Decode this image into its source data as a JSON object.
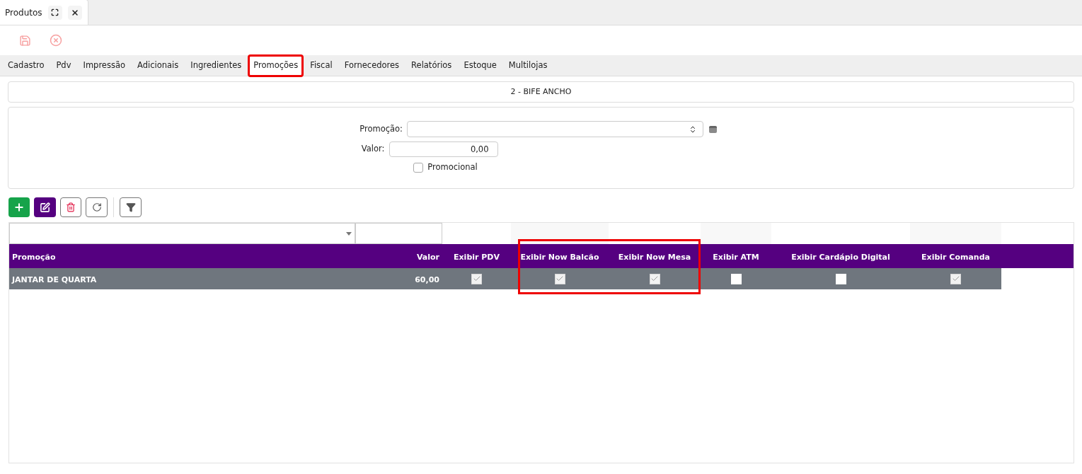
{
  "window_tab": {
    "title": "Produtos"
  },
  "tabs": [
    {
      "label": "Cadastro",
      "selected": false,
      "highlighted": false
    },
    {
      "label": "Pdv",
      "selected": false,
      "highlighted": false
    },
    {
      "label": "Impressão",
      "selected": false,
      "highlighted": false
    },
    {
      "label": "Adicionais",
      "selected": false,
      "highlighted": false
    },
    {
      "label": "Ingredientes",
      "selected": false,
      "highlighted": false
    },
    {
      "label": "Promoções",
      "selected": true,
      "highlighted": true
    },
    {
      "label": "Fiscal",
      "selected": false,
      "highlighted": false
    },
    {
      "label": "Fornecedores",
      "selected": false,
      "highlighted": false
    },
    {
      "label": "Relatórios",
      "selected": false,
      "highlighted": false
    },
    {
      "label": "Estoque",
      "selected": false,
      "highlighted": false
    },
    {
      "label": "Multilojas",
      "selected": false,
      "highlighted": false
    }
  ],
  "product_title": "2 - BIFE ANCHO",
  "form": {
    "promocao_label": "Promoção:",
    "valor_label": "Valor:",
    "valor_value": "0,00",
    "promocional_label": "Promocional",
    "promocional_checked": false
  },
  "table": {
    "columns": [
      {
        "label": "Promoção",
        "highlighted": false
      },
      {
        "label": "Valor",
        "highlighted": false
      },
      {
        "label": "Exibir PDV",
        "highlighted": false
      },
      {
        "label": "Exibir Now Balcão",
        "highlighted": true
      },
      {
        "label": "Exibir Now Mesa",
        "highlighted": true
      },
      {
        "label": "Exibir ATM",
        "highlighted": false
      },
      {
        "label": "Exibir Cardápio Digital",
        "highlighted": false
      },
      {
        "label": "Exibir Comanda",
        "highlighted": false
      }
    ],
    "rows": [
      {
        "promocao": "JANTAR DE QUARTA",
        "valor": "60,00",
        "selected": true,
        "flags": [
          true,
          true,
          true,
          false,
          false,
          true
        ]
      }
    ]
  }
}
